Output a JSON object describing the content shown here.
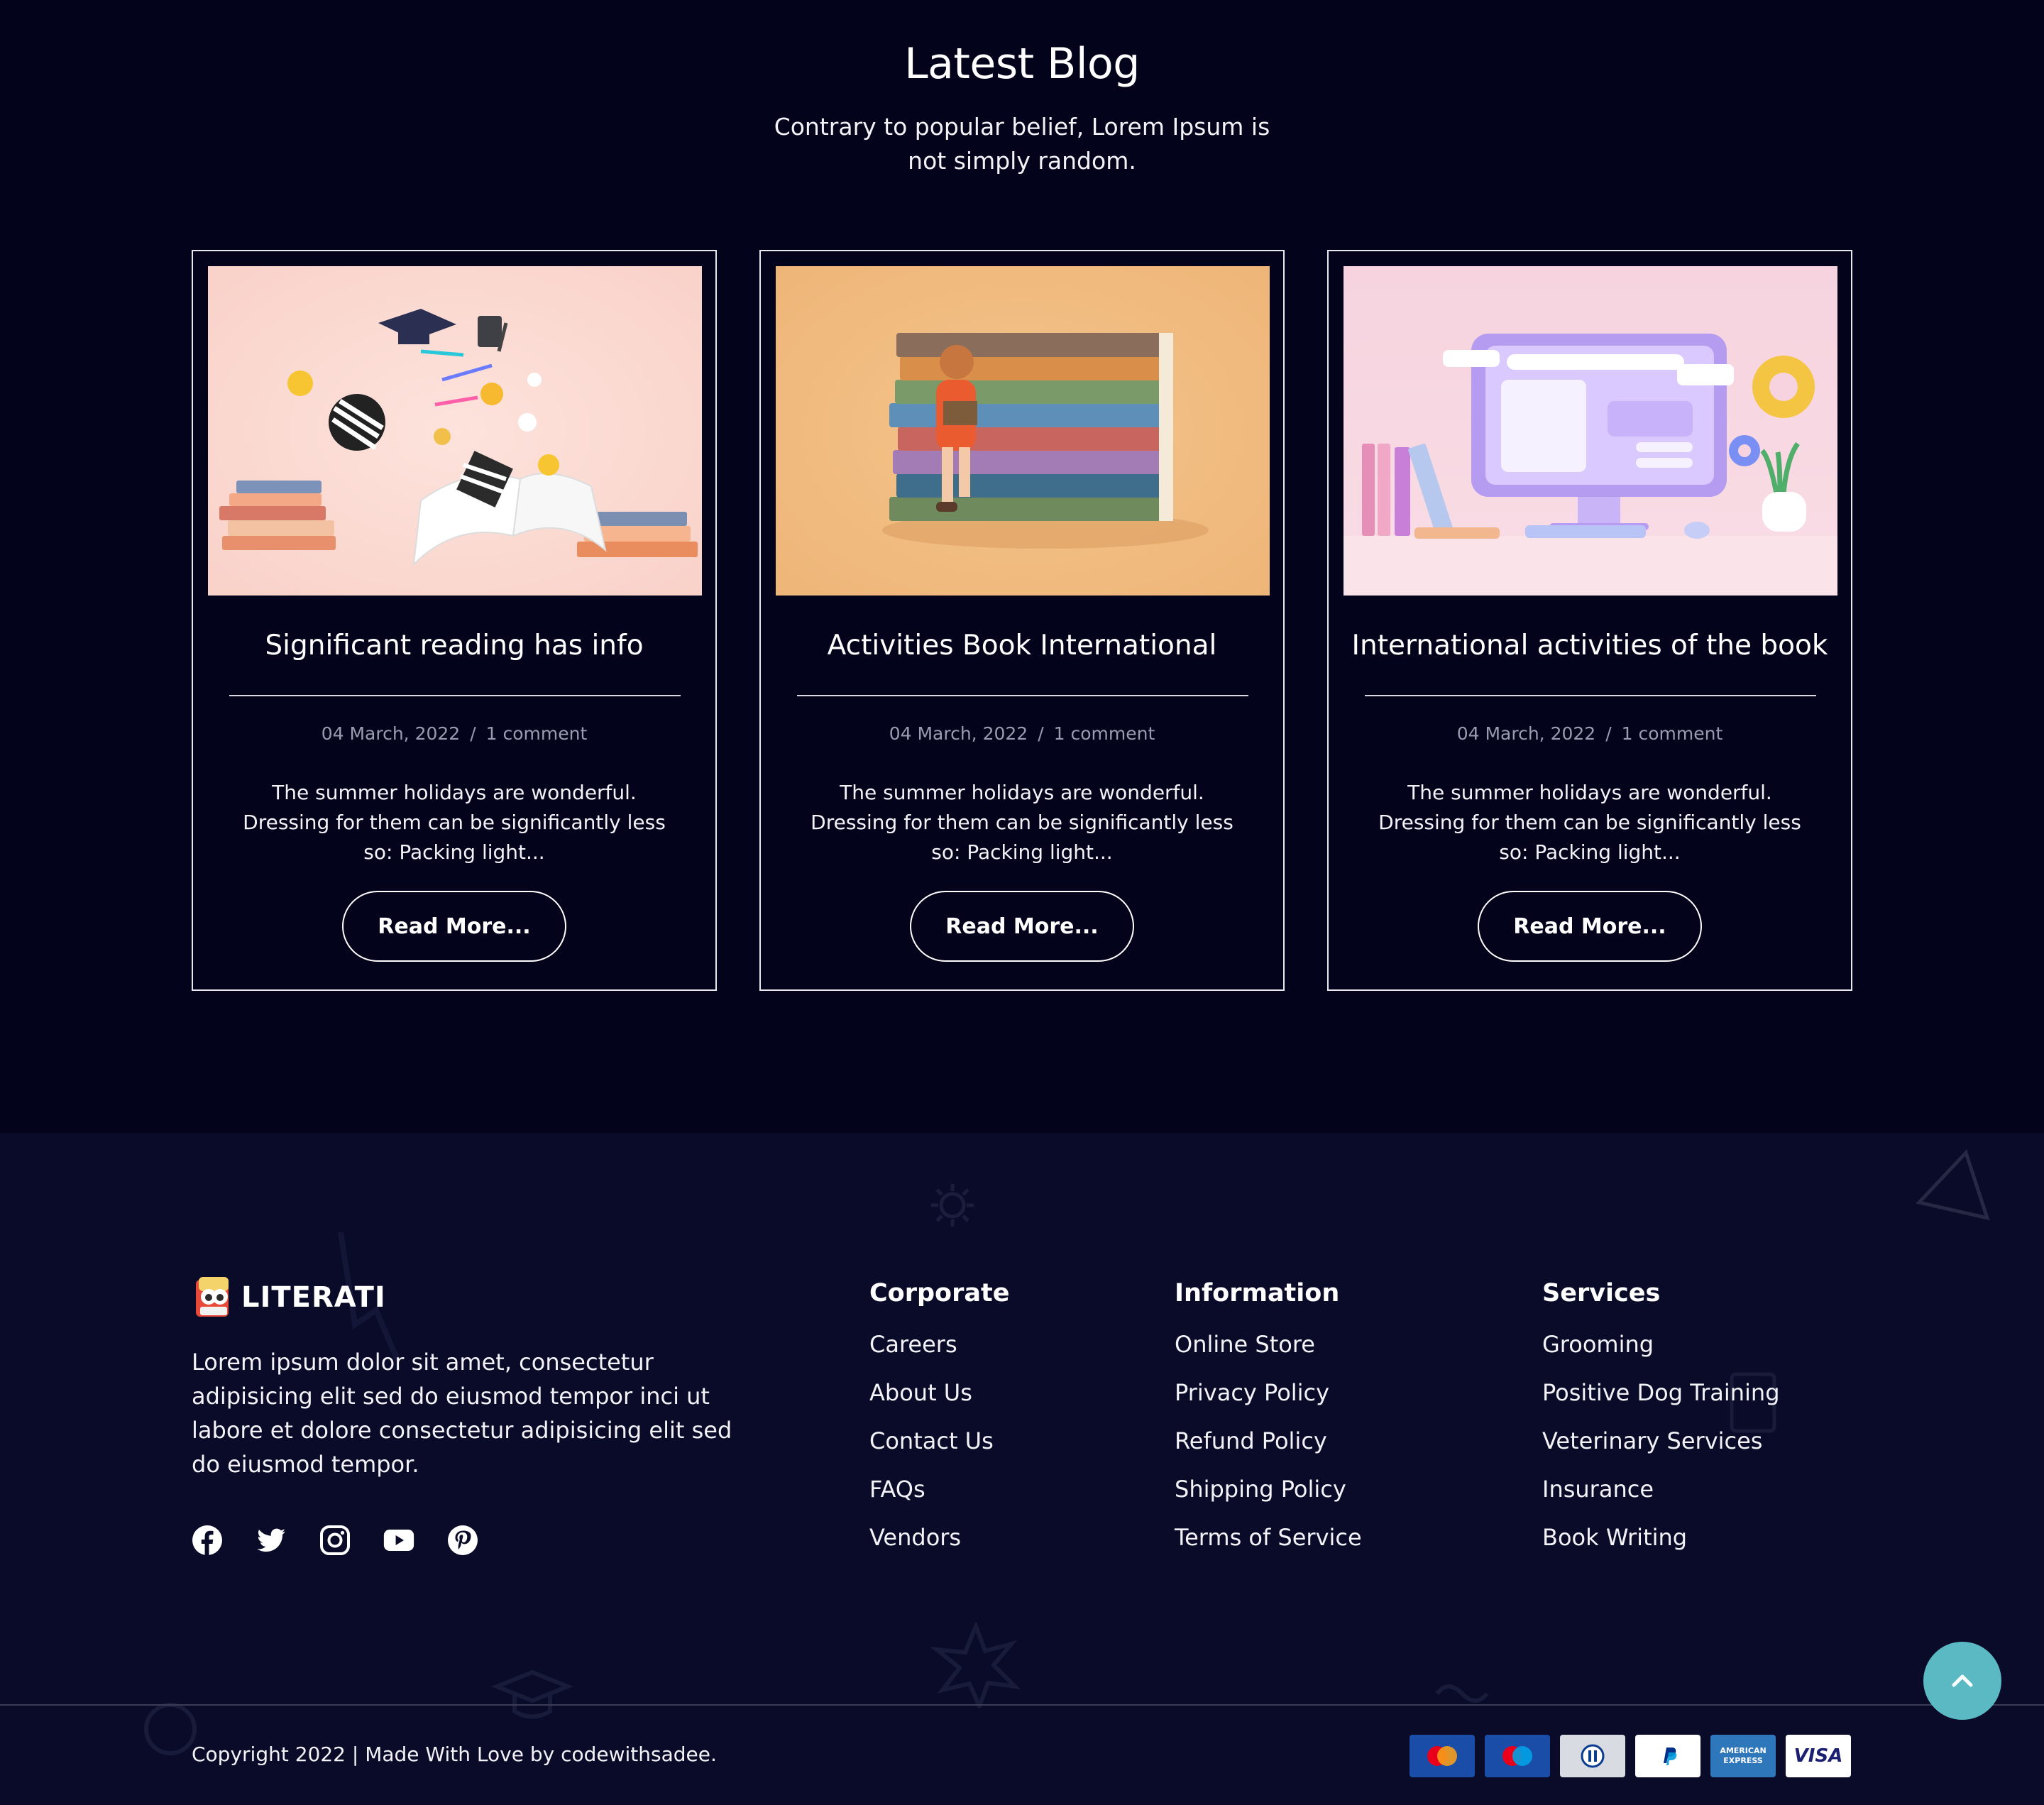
{
  "blog": {
    "title": "Latest Blog",
    "subtitle": "Contrary to popular belief, Lorem Ipsum is not simply random.",
    "posts": [
      {
        "title": "Significant reading has info",
        "date": "04 March, 2022",
        "separator": "/",
        "comments": "1 comment",
        "excerpt": "The summer holidays are wonderful. Dressing for them can be significantly less so: Packing light...",
        "button": "Read More..."
      },
      {
        "title": "Activities Book International",
        "date": "04 March, 2022",
        "separator": "/",
        "comments": "1 comment",
        "excerpt": "The summer holidays are wonderful. Dressing for them can be significantly less so: Packing light...",
        "button": "Read More..."
      },
      {
        "title": "International activities of the book",
        "date": "04 March, 2022",
        "separator": "/",
        "comments": "1 comment",
        "excerpt": "The summer holidays are wonderful. Dressing for them can be significantly less so: Packing light...",
        "button": "Read More..."
      }
    ]
  },
  "footer": {
    "brand": "LITERATI",
    "about": "Lorem ipsum dolor sit amet, consectetur adipisicing elit sed do eiusmod tempor inci ut labore et dolore consectetur adipisicing elit sed do eiusmod tempor.",
    "socials": [
      "facebook-icon",
      "twitter-icon",
      "instagram-icon",
      "youtube-icon",
      "pinterest-icon"
    ],
    "columns": [
      {
        "heading": "Corporate",
        "links": [
          "Careers",
          "About Us",
          "Contact Us",
          "FAQs",
          "Vendors"
        ]
      },
      {
        "heading": "Information",
        "links": [
          "Online Store",
          "Privacy Policy",
          "Refund Policy",
          "Shipping Policy",
          "Terms of Service"
        ]
      },
      {
        "heading": "Services",
        "links": [
          "Grooming",
          "Positive Dog Training",
          "Veterinary Services",
          "Insurance",
          "Book Writing"
        ]
      }
    ],
    "copyright": "Copyright 2022 | Made With Love by codewithsadee.",
    "payments": [
      "mastercard-icon",
      "maestro-icon",
      "diners-club-icon",
      "paypal-icon",
      "american-express-icon",
      "visa-icon"
    ],
    "payment_labels": {
      "amex": "AMERICAN EXPRESS",
      "visa": "VISA"
    }
  },
  "colors": {
    "background": "#03031c",
    "footer_background": "#0a0b28",
    "accent": "#5ab9c3"
  }
}
